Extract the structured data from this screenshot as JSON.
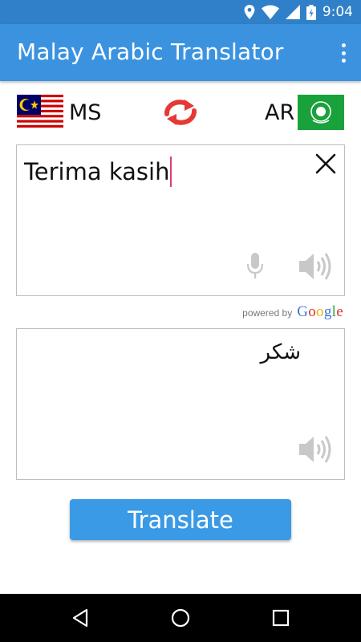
{
  "status_bar": {
    "time": "9:04",
    "icons": [
      "location-icon",
      "wifi-icon",
      "signal-icon",
      "battery-icon"
    ]
  },
  "app_bar": {
    "title": "Malay Arabic Translator",
    "menu_icon": "overflow-menu-icon"
  },
  "languages": {
    "source_code": "MS",
    "source_flag": "malaysia-flag",
    "target_code": "AR",
    "target_flag": "arab-league-flag",
    "swap_icon": "swap-arrows-icon"
  },
  "input": {
    "text": "Terima kasih",
    "clear_icon": "close-icon",
    "mic_icon": "microphone-icon",
    "speaker_icon": "speaker-icon"
  },
  "attribution": {
    "label": "powered by",
    "brand": "Google"
  },
  "output": {
    "text": "شكر",
    "speaker_icon": "speaker-icon"
  },
  "actions": {
    "translate_label": "Translate"
  },
  "navigation": {
    "icons": [
      "back-icon",
      "home-icon",
      "recents-icon"
    ]
  },
  "colors": {
    "status_bar": "#2f80c9",
    "app_bar": "#3b93e0",
    "button": "#3b9ae5",
    "swap_icon": "#e53935",
    "caret": "#d9416b"
  }
}
